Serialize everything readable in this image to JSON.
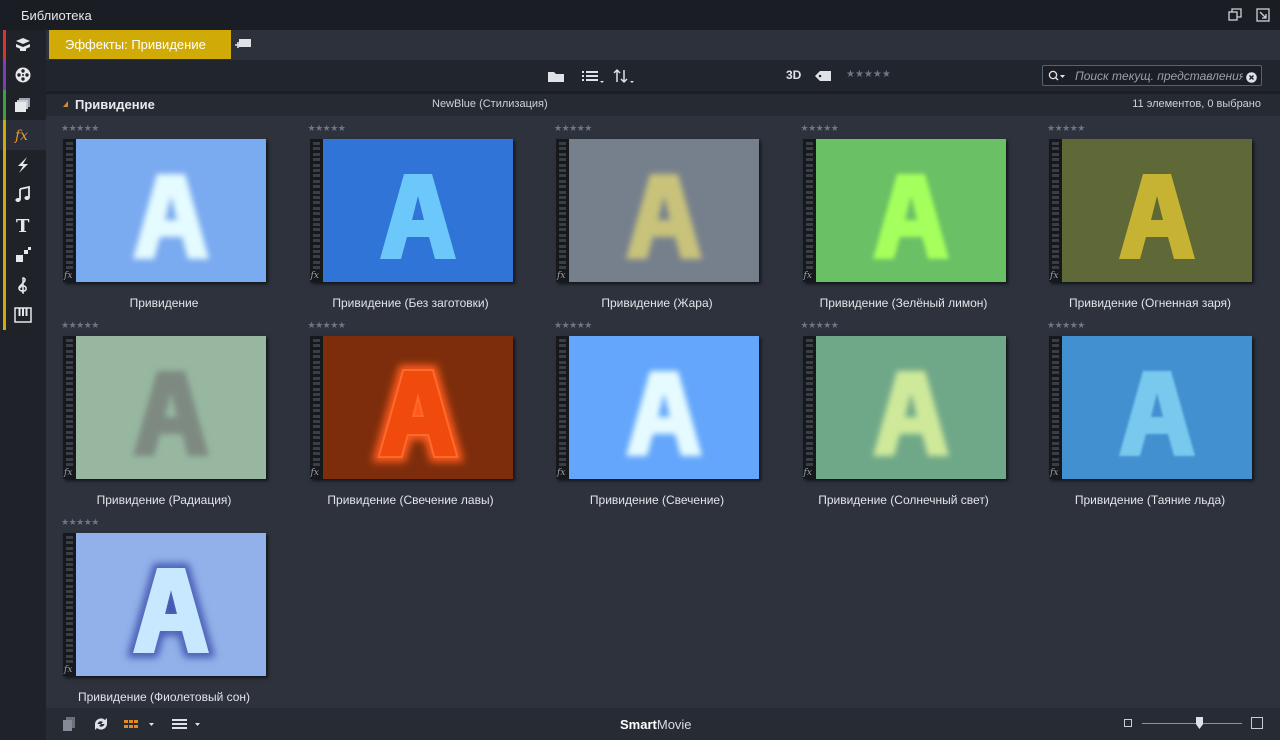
{
  "window": {
    "title": "Библиотека"
  },
  "sidebar": {
    "items": [
      {
        "name": "collection",
        "icon": "collection-icon",
        "stripe": "#d9342b"
      },
      {
        "name": "media",
        "icon": "film-reel-icon",
        "stripe": "#7a3fb3"
      },
      {
        "name": "projects",
        "icon": "projects-icon",
        "stripe": "#3aa33a"
      },
      {
        "name": "effects",
        "icon": "fx-icon",
        "stripe": "#d0aa07",
        "active": true
      },
      {
        "name": "transitions",
        "icon": "lightning-icon",
        "stripe": "#d0aa07"
      },
      {
        "name": "sounds",
        "icon": "music-note-icon",
        "stripe": "#d0aa07"
      },
      {
        "name": "titles",
        "icon": "title-t-icon",
        "stripe": "#d0aa07"
      },
      {
        "name": "montage",
        "icon": "montage-icon",
        "stripe": "#d0aa07"
      },
      {
        "name": "music",
        "icon": "treble-clef-icon",
        "stripe": "#d0aa07"
      },
      {
        "name": "scorefitter",
        "icon": "piano-icon",
        "stripe": "#d0aa07"
      }
    ]
  },
  "tabs": {
    "active_label": "Эффекты: Привидение"
  },
  "toolbar": {
    "three_d_label": "3D",
    "rating_stars": "★★★★★"
  },
  "search": {
    "placeholder": "Поиск текущ. представления",
    "value": ""
  },
  "section": {
    "title": "Привидение",
    "group": "NewBlue (Стилизация)",
    "count": "11 элементов, 0 выбрано"
  },
  "items": [
    {
      "label": "Привидение",
      "stars": "★★★★★",
      "bg": "#7aaaf0",
      "letter": "#e4fbff",
      "blur": 3,
      "glow": false
    },
    {
      "label": "Привидение (Без заготовки)",
      "stars": "★★★★★",
      "bg": "#2f74d6",
      "letter": "#6cc8fa",
      "blur": 0,
      "glow": false
    },
    {
      "label": "Привидение (Жара)",
      "stars": "★★★★★",
      "bg": "#76808d",
      "letter": "#c8c27a",
      "blur": 3,
      "glow": false
    },
    {
      "label": "Привидение (Зелёный лимон)",
      "stars": "★★★★★",
      "bg": "#6ac065",
      "letter": "#a5ff5c",
      "blur": 2,
      "glow": false
    },
    {
      "label": "Привидение (Огненная заря)",
      "stars": "★★★★★",
      "bg": "#5f6938",
      "letter": "#c6b333",
      "blur": 0,
      "glow": false
    },
    {
      "label": "Привидение (Радиация)",
      "stars": "★★★★★",
      "bg": "#97b7a1",
      "letter": "#7e8a81",
      "blur": 3,
      "glow": false
    },
    {
      "label": "Привидение (Свечение лавы)",
      "stars": "★★★★★",
      "bg": "#7d2d0c",
      "letter": "#f04a0c",
      "blur": 0,
      "glow": true
    },
    {
      "label": "Привидение (Свечение)",
      "stars": "★★★★★",
      "bg": "#63a6fb",
      "letter": "#e6fbff",
      "blur": 3,
      "glow": false
    },
    {
      "label": "Привидение (Солнечный свет)",
      "stars": "★★★★★",
      "bg": "#6fa889",
      "letter": "#cfe99a",
      "blur": 3,
      "glow": false
    },
    {
      "label": "Привидение (Таяние льда)",
      "stars": "★★★★★",
      "bg": "#4390d1",
      "letter": "#79c8ee",
      "blur": 1,
      "glow": false
    },
    {
      "label": "Привидение (Фиолетовый сон)",
      "stars": "★★★★★",
      "bg": "#92b1ea",
      "letter": "#c7e8ff",
      "blur": 0,
      "glow": false,
      "outline": "#4257b0"
    }
  ],
  "bottom": {
    "brand_bold": "Smart",
    "brand_rest": "Movie",
    "zoom_level": 0.57
  }
}
